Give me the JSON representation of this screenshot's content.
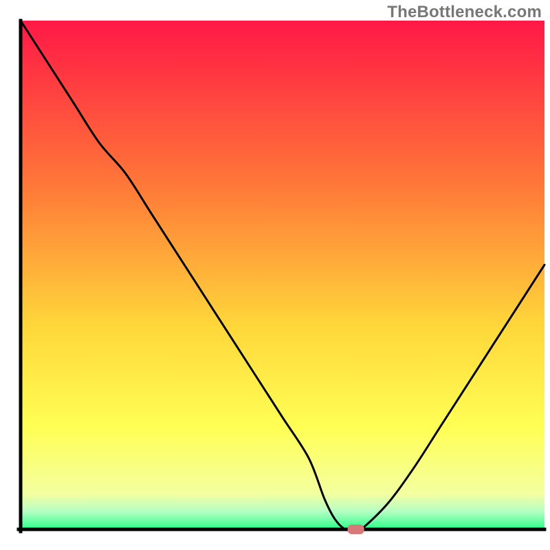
{
  "watermark": "TheBottleneck.com",
  "chart_data": {
    "type": "line",
    "title": "",
    "xlabel": "",
    "ylabel": "",
    "xlim": [
      0,
      100
    ],
    "ylim": [
      0,
      100
    ],
    "x": [
      0,
      5,
      10,
      15,
      20,
      25,
      30,
      35,
      40,
      45,
      50,
      55,
      58,
      60,
      62,
      64,
      65,
      70,
      75,
      80,
      85,
      90,
      95,
      100
    ],
    "y": [
      100,
      92,
      84,
      76,
      70,
      62,
      54,
      46,
      38,
      30,
      22,
      14,
      6,
      2,
      0,
      0,
      0,
      5,
      12,
      20,
      28,
      36,
      44,
      52
    ],
    "marker": {
      "x": 64,
      "y": 0,
      "color": "#d87979"
    },
    "background": {
      "type": "vertical-gradient",
      "stops": [
        {
          "pos": 0.0,
          "color": "#ff1846"
        },
        {
          "pos": 0.33,
          "color": "#ff7a38"
        },
        {
          "pos": 0.6,
          "color": "#ffd73a"
        },
        {
          "pos": 0.8,
          "color": "#ffff55"
        },
        {
          "pos": 0.93,
          "color": "#f4ffa0"
        },
        {
          "pos": 0.965,
          "color": "#b4ffc4"
        },
        {
          "pos": 1.0,
          "color": "#2aff87"
        }
      ]
    },
    "axes": {
      "color": "#000000",
      "width": 5
    }
  }
}
